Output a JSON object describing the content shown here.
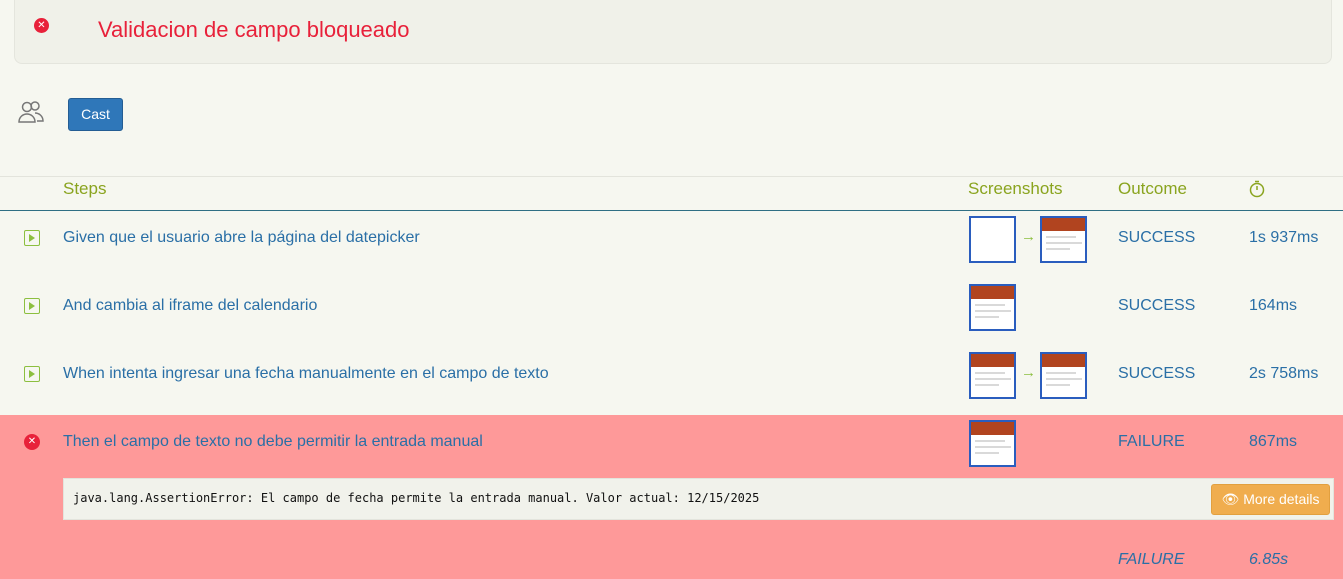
{
  "scenario": {
    "title": "Validacion de campo bloqueado",
    "status_icon": "error-icon"
  },
  "tags": {
    "icon": "people-icon",
    "cast_label": "Cast"
  },
  "table": {
    "headers": {
      "steps": "Steps",
      "screenshots": "Screenshots",
      "outcome": "Outcome",
      "duration_icon": "stopwatch-icon"
    },
    "rows": [
      {
        "step": "Given que el usuario abre la página del datepicker",
        "outcome": "SUCCESS",
        "duration": "1s 937ms",
        "icon": "play-icon"
      },
      {
        "step": "And cambia al iframe del calendario",
        "outcome": "SUCCESS",
        "duration": "164ms",
        "icon": "play-icon"
      },
      {
        "step": "When intenta ingresar una fecha manualmente en el campo de texto",
        "outcome": "SUCCESS",
        "duration": "2s 758ms",
        "icon": "play-icon"
      },
      {
        "step": "Then el campo de texto no debe permitir la entrada manual",
        "outcome": "FAILURE",
        "duration": "867ms",
        "icon": "error-icon"
      }
    ],
    "error_message": "java.lang.AssertionError: El campo de fecha permite la entrada manual. Valor actual: 12/15/2025",
    "more_details_label": "More details",
    "summary": {
      "outcome": "FAILURE",
      "duration": "6.85s"
    }
  },
  "colors": {
    "background": "#f6f7f0",
    "failure_row": "#fe9999",
    "error_red": "#e8213a",
    "header_green": "#8aa41f",
    "link_blue": "#2a6fa6",
    "cast_button": "#2f77b9",
    "details_button": "#f0ad4e"
  }
}
